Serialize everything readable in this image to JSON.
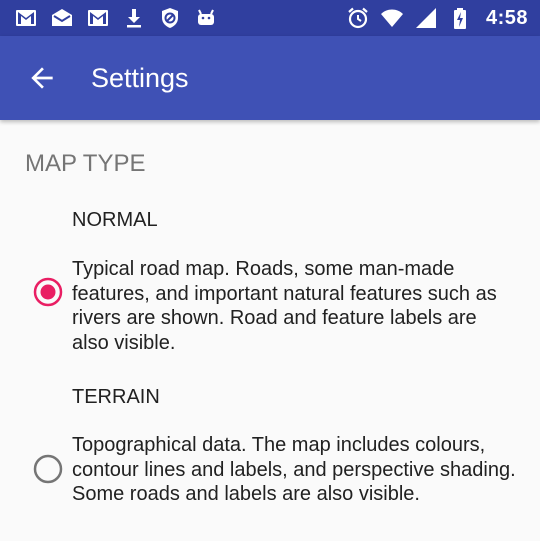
{
  "status_bar": {
    "left_icons": [
      "gmail-icon",
      "mail-open-icon",
      "gmail-icon",
      "download-icon",
      "blocked-icon",
      "android-icon"
    ],
    "right_icons": [
      "alarm-icon",
      "wifi-icon",
      "signal-icon",
      "battery-charging-icon"
    ],
    "time": "4:58"
  },
  "app_bar": {
    "title": "Settings",
    "background": "#3f51b5",
    "status_background": "#303f9f"
  },
  "section": {
    "header": "MAP TYPE"
  },
  "options": [
    {
      "title": "NORMAL",
      "description": "Typical road map. Roads, some man-made features, and important natural features such as rivers are shown. Road and feature labels are also visible.",
      "selected": true
    },
    {
      "title": "TERRAIN",
      "description": "Topographical data. The map includes colours, contour lines and labels, and perspective shading. Some roads and labels are also visible.",
      "selected": false
    }
  ],
  "colors": {
    "accent": "#e91e63",
    "radio_unselected": "#757575"
  }
}
